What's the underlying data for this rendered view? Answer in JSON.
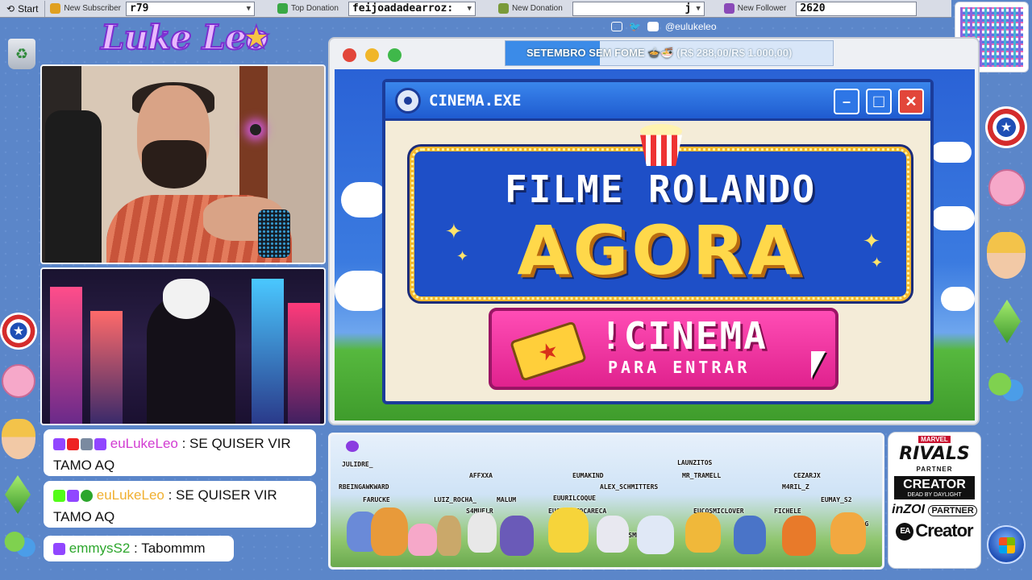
{
  "taskbar": {
    "start_label": "Start",
    "new_subscriber_label": "New Subscriber",
    "new_subscriber_value": "r79",
    "top_donation_label": "Top Donation",
    "top_donation_value": "feijoadadearroz:",
    "new_donation_label": "New Donation",
    "new_donation_value": "j",
    "new_follower_label": "New Follower",
    "new_follower_value": "2620"
  },
  "brand": {
    "logo": "Luke Leo",
    "social_handle": "@eulukeleo"
  },
  "goal": {
    "text": "SETEMBRO SEM FOME",
    "emoji": "🍲🍜",
    "amount": "(R$ 288,00/R$ 1.000,00)",
    "progress": 0.288
  },
  "cinema_window": {
    "title": "CINEMA.EXE",
    "minimize": "–",
    "maximize": "□",
    "close": "✕",
    "headline_1": "FILME ROLANDO",
    "headline_2": "AGORA",
    "command": "!CINEMA",
    "command_sub": "PARA ENTRAR",
    "ticket_star": "★"
  },
  "chat": {
    "messages": [
      {
        "user": "euLukeLeo",
        "text": "SE QUISER VIR TAMO AQ"
      },
      {
        "user": "euLukeLeo",
        "text": "SE QUISER VIR TAMO AQ"
      },
      {
        "user": "emmysS2",
        "text": "Tabommm"
      }
    ]
  },
  "viewers": {
    "names": [
      "JULIDRE_",
      "RBEINGAWKWARD",
      "FARUCKE",
      "AFFXXA",
      "LUIZ_ROCHA_",
      "MALUM",
      "S4MUELR",
      "EUMAKIND",
      "EUURILCOQUE",
      "ALEX_SCHMITTERS",
      "EUCABRITOCARECA",
      "GURBSMP",
      "LAUNZITOS",
      "MR_TRAMELL",
      "EUCOSMICLOVER",
      "FICHELE",
      "CEZARJX",
      "M4RIL_Z",
      "EUMAY_S2",
      "OUTROJORG"
    ]
  },
  "partners": {
    "marvel": "MARVEL",
    "rivals": "RIVALS",
    "rivals_sub": "PARTNER",
    "creator": "CREATOR",
    "creator_sub": "DEAD BY DAYLIGHT",
    "inzoi": "inZOI",
    "inzoi_sub": "PARTNER",
    "ea_mark": "EA",
    "ea": "Creator"
  }
}
